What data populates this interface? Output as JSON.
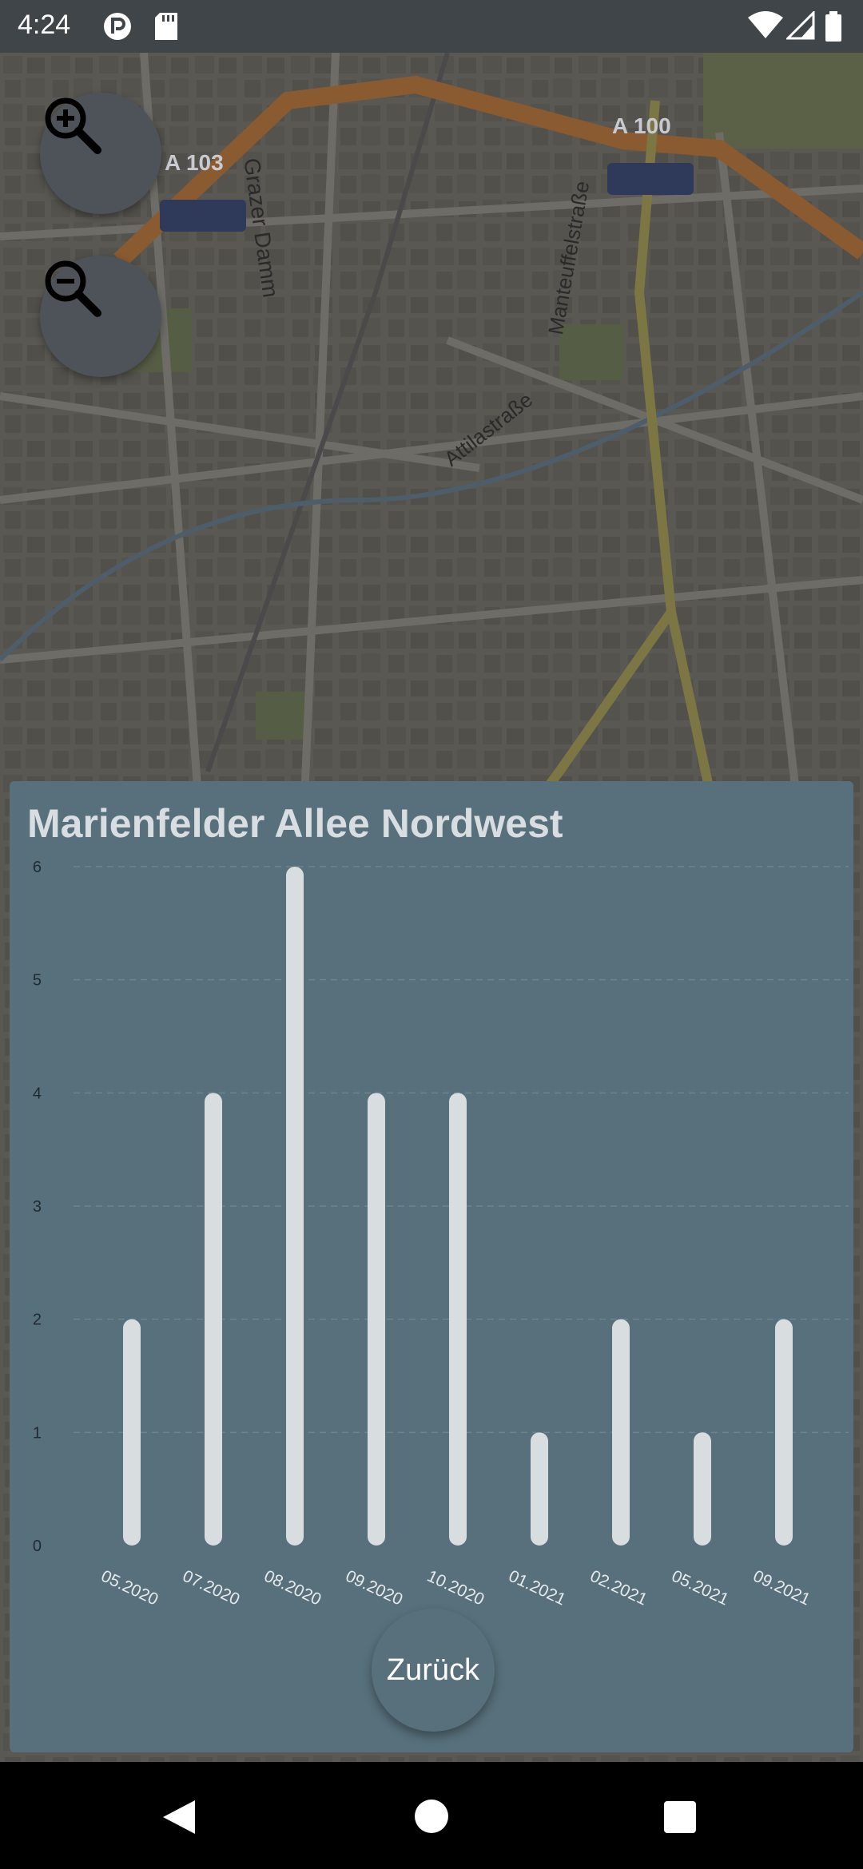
{
  "status_bar": {
    "time": "4:24"
  },
  "map": {
    "labels": {
      "a103": "A 103",
      "a100": "A 100",
      "grazer_damm": "Grazer Damm",
      "manteuffelstrasse": "Manteuffelstraße",
      "attilastrasse": "Attilastraße"
    }
  },
  "sheet": {
    "title": "Marienfelder Allee Nordwest",
    "back_label": "Zurück"
  },
  "chart_data": {
    "type": "bar",
    "categories": [
      "05.2020",
      "07.2020",
      "08.2020",
      "09.2020",
      "10.2020",
      "01.2021",
      "02.2021",
      "05.2021",
      "09.2021"
    ],
    "values": [
      2,
      4,
      6,
      4,
      4,
      1,
      2,
      1,
      2
    ],
    "ylim": [
      0,
      6
    ],
    "yticks": [
      "0",
      "1",
      "2",
      "3",
      "4",
      "5",
      "6"
    ],
    "grid": true,
    "bar_color": "#d8dde0",
    "label_color": "#e6eaec"
  }
}
